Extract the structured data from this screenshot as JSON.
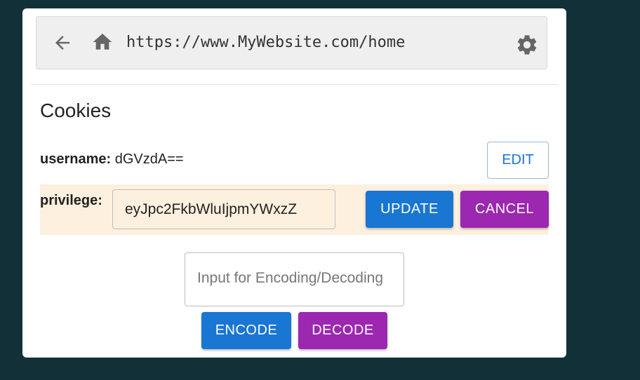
{
  "browser": {
    "url": "https://www.MyWebsite.com/home",
    "icons": [
      "back-arrow-icon",
      "home-icon",
      "gear-icon"
    ]
  },
  "page": {
    "title": "Cookies"
  },
  "cookies": {
    "username": {
      "key": "username:",
      "value": "dGVzdA==",
      "edit_label": "EDIT"
    },
    "privilege": {
      "key": "privilege:",
      "value": "eyJpc2FkbWluIjpmYWxzZ",
      "update_label": "UPDATE",
      "cancel_label": "CANCEL"
    }
  },
  "encoder": {
    "placeholder": "Input for Encoding/Decoding",
    "encode_label": "ENCODE",
    "decode_label": "DECODE"
  },
  "colors": {
    "background": "#123038",
    "primary": "#1976d2",
    "secondary": "#9c27b0",
    "highlight_row": "#fdf0de"
  }
}
